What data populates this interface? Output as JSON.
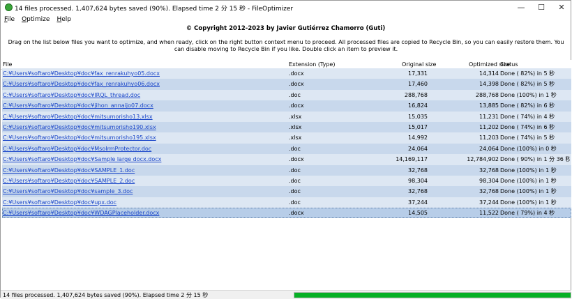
{
  "window": {
    "title": "14 files processed. 1,407,624 bytes saved (90%). Elapsed time  2 分 15 秒 - FileOptimizer",
    "controls": {
      "minimize": "—",
      "maximize": "☐",
      "close": "✕"
    }
  },
  "menu": [
    {
      "label": "File"
    },
    {
      "label": "Optimize"
    },
    {
      "label": "Help"
    }
  ],
  "copyright": "© Copyright 2012-2023 by Javier Gutiérrez Chamorro (Guti)",
  "instructions": "Drag on the list below files you want to optimize, and when ready, click on the right button context menu to proceed. All processed files are copied to Recycle Bin, so you can easily restore them. You can disable moving to Recycle Bin if you like. Double click an item to preview it.",
  "table": {
    "headers": {
      "file": "File",
      "extension": "Extension (Type)",
      "original": "Original size",
      "optimized": "Optimized size",
      "status": "Status"
    },
    "rows": [
      {
        "file": "C:¥Users¥softaro¥Desktop¥doc¥fax_renrakuhyo05.docx",
        "ext": ".docx",
        "orig": "17,331",
        "opt": "14,314",
        "status": "Done ( 82%) in  5 秒"
      },
      {
        "file": "C:¥Users¥softaro¥Desktop¥doc¥fax_renrakuhyo06.docx",
        "ext": ".docx",
        "orig": "17,460",
        "opt": "14,398",
        "status": "Done ( 82%) in  5 秒"
      },
      {
        "file": "C:¥Users¥softaro¥Desktop¥doc¥IRQL_thread.doc",
        "ext": ".doc",
        "orig": "288,768",
        "opt": "288,768",
        "status": "Done (100%) in  1 秒"
      },
      {
        "file": "C:¥Users¥softaro¥Desktop¥doc¥jihon_annaijo07.docx",
        "ext": ".docx",
        "orig": "16,824",
        "opt": "13,885",
        "status": "Done ( 82%) in  6 秒"
      },
      {
        "file": "C:¥Users¥softaro¥Desktop¥doc¥mitsumorisho13.xlsx",
        "ext": ".xlsx",
        "orig": "15,035",
        "opt": "11,231",
        "status": "Done ( 74%) in  4 秒"
      },
      {
        "file": "C:¥Users¥softaro¥Desktop¥doc¥mitsumorisho190.xlsx",
        "ext": ".xlsx",
        "orig": "15,017",
        "opt": "11,202",
        "status": "Done ( 74%) in  6 秒"
      },
      {
        "file": "C:¥Users¥softaro¥Desktop¥doc¥mitsumorisho195.xlsx",
        "ext": ".xlsx",
        "orig": "14,992",
        "opt": "11,203",
        "status": "Done ( 74%) in  5 秒"
      },
      {
        "file": "C:¥Users¥softaro¥Desktop¥doc¥MsoIrmProtector.doc",
        "ext": ".doc",
        "orig": "24,064",
        "opt": "24,064",
        "status": "Done (100%) in  0 秒"
      },
      {
        "file": "C:¥Users¥softaro¥Desktop¥doc¥Sample large docx.docx",
        "ext": ".docx",
        "orig": "14,169,117",
        "opt": "12,784,902",
        "status": "Done ( 90%) in  1 分 36 秒"
      },
      {
        "file": "C:¥Users¥softaro¥Desktop¥doc¥SAMPLE_1.doc",
        "ext": ".doc",
        "orig": "32,768",
        "opt": "32,768",
        "status": "Done (100%) in  1 秒"
      },
      {
        "file": "C:¥Users¥softaro¥Desktop¥doc¥SAMPLE_2.doc",
        "ext": ".doc",
        "orig": "98,304",
        "opt": "98,304",
        "status": "Done (100%) in  1 秒"
      },
      {
        "file": "C:¥Users¥softaro¥Desktop¥doc¥sample_3.doc",
        "ext": ".doc",
        "orig": "32,768",
        "opt": "32,768",
        "status": "Done (100%) in  1 秒"
      },
      {
        "file": "C:¥Users¥softaro¥Desktop¥doc¥upx.doc",
        "ext": ".doc",
        "orig": "37,244",
        "opt": "37,244",
        "status": "Done (100%) in  1 秒"
      },
      {
        "file": "C:¥Users¥softaro¥Desktop¥doc¥WDAGPlaceholder.docx",
        "ext": ".docx",
        "orig": "14,505",
        "opt": "11,522",
        "status": "Done ( 79%) in  4 秒"
      }
    ]
  },
  "statusbar": {
    "text": "14 files processed. 1,407,624 bytes saved (90%). Elapsed time  2 分 15 秒",
    "progress_percent": 100,
    "progress_color": "#06b025"
  }
}
